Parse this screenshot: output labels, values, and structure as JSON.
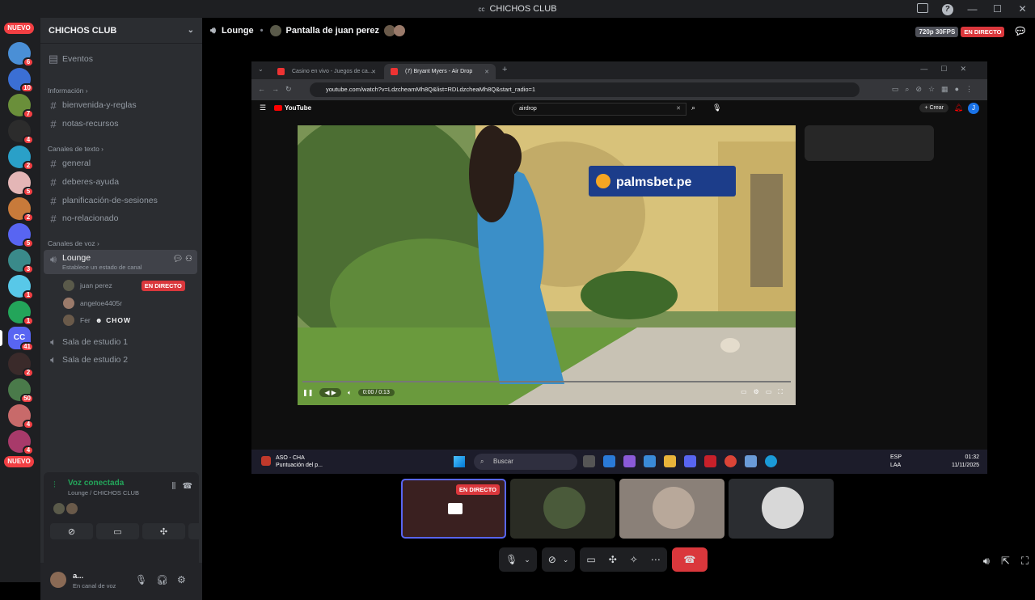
{
  "window": {
    "title": "CHICHOS CLUB",
    "logo": "cc",
    "controls": [
      "screen-share-icon",
      "help-icon",
      "minimize-icon",
      "maximize-icon",
      "close-icon"
    ]
  },
  "guilds": {
    "top_badge": "NUEVO",
    "bottom_badge": "NUEVO",
    "items": [
      {
        "badge": "6",
        "color": "#4a8fd6"
      },
      {
        "badge": "10",
        "color": "#3b6fd4"
      },
      {
        "badge": "7",
        "color": "#6a8f3a"
      },
      {
        "badge": "4",
        "color": "#2c2c2c"
      },
      {
        "badge": "2",
        "color": "#2aa0c8"
      },
      {
        "badge": "5",
        "color": "#e4b6b6"
      },
      {
        "badge": "2",
        "color": "#c87a3a"
      },
      {
        "badge": "5",
        "color": "#5865f2"
      },
      {
        "badge": "3",
        "color": "#3a8a8a"
      },
      {
        "badge": "1",
        "color": "#58c8e8"
      },
      {
        "badge": "1",
        "color": "#23a55a"
      },
      {
        "badge": "41",
        "color": "#5865f2",
        "label": "CC"
      },
      {
        "badge": "2",
        "color": "#3a2a2a"
      },
      {
        "badge": "50",
        "color": "#4a7a4a"
      },
      {
        "badge": "4",
        "color": "#c86a6a"
      },
      {
        "badge": "4",
        "color": "#a83a6a"
      }
    ]
  },
  "sidebar": {
    "server_name": "CHICHOS CLUB",
    "events": "Eventos",
    "categories": {
      "info": "Información",
      "text": "Canales de texto",
      "voice": "Canales de voz"
    },
    "info_channels": [
      "bienvenida-y-reglas",
      "notas-recursos"
    ],
    "text_channels": [
      "general",
      "deberes-ayuda",
      "planificación-de-sesiones",
      "no-relacionado"
    ],
    "voice_active": {
      "name": "Lounge",
      "status_prompt": "Establece un estado de canal"
    },
    "voice_users": [
      {
        "name": "juan perez",
        "live": "EN DIRECTO",
        "color": "#5a5a4a"
      },
      {
        "name": "angeloe4405r",
        "color": "#9a7a6a"
      },
      {
        "name": "Fer",
        "tag": "CHOW",
        "color": "#6a5a4a"
      }
    ],
    "voice_channels": [
      "Sala de estudio 1",
      "Sala de estudio 2"
    ]
  },
  "voice_panel": {
    "title": "Voz conectada",
    "subtitle": "Lounge / CHICHOS CLUB"
  },
  "user": {
    "name": "a...",
    "status": "En canal de voz"
  },
  "header": {
    "channel": "Lounge",
    "stream": "Pantalla de juan perez",
    "quality": "720p 30FPS",
    "live": "EN DIRECTO"
  },
  "browser": {
    "tabs": [
      "Casino en vivo - Juegos de ca...",
      "(7) Bryant Myers - Air Drop"
    ],
    "url": "youtube.com/watch?v=Ldzcheam­Mh8Q&list=RDLdzcheaMh8Q&start_radio=1",
    "yt_logo": "YouTube",
    "search": "airdrop",
    "create": "+ Crear",
    "ad_text": "palmsbet.pe",
    "time": "0:00 / 0:13"
  },
  "taskbar": {
    "notif_title": "ASO - CHA",
    "notif_sub": "Puntuación del p...",
    "search": "Buscar",
    "lang1": "ESP",
    "lang2": "LAA",
    "time": "01:32",
    "date": "11/11/2025"
  },
  "tiles": [
    {
      "live": "EN DIRECTO",
      "color": "#3a2020"
    },
    {
      "color": "#2a2c24",
      "avatar": "#4a5a3a"
    },
    {
      "color": "#8a8078",
      "avatar": "#b8a89a"
    },
    {
      "color": "#2b2d31",
      "avatar": "#d8d8d8"
    }
  ]
}
